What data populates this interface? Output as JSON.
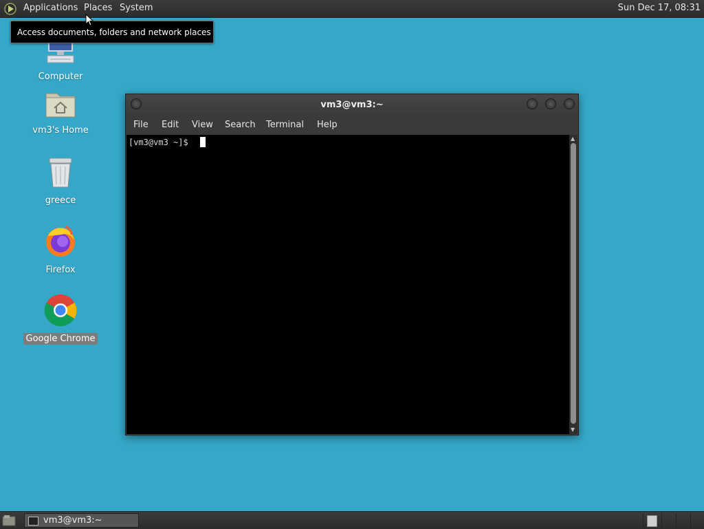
{
  "top_panel": {
    "menus": [
      "Applications",
      "Places",
      "System"
    ],
    "clock": "Sun Dec 17, 08:31"
  },
  "tooltip": "Access documents, folders and network places",
  "desktop_icons": [
    {
      "label": "Computer",
      "icon": "computer-icon"
    },
    {
      "label": "vm3's Home",
      "icon": "home-folder-icon"
    },
    {
      "label": "greece",
      "icon": "trash-icon"
    },
    {
      "label": "Firefox",
      "icon": "firefox-icon"
    },
    {
      "label": "Google Chrome",
      "icon": "chrome-icon",
      "selected": true
    }
  ],
  "terminal": {
    "title": "vm3@vm3:~",
    "menus": [
      "File",
      "Edit",
      "View",
      "Search",
      "Terminal",
      "Help"
    ],
    "prompt": "[vm3@vm3 ~]$"
  },
  "taskbar": {
    "window_label": "vm3@vm3:~"
  },
  "colors": {
    "desktop": "#35a8c9",
    "panel": "#333333",
    "terminal_bg": "#000000"
  }
}
